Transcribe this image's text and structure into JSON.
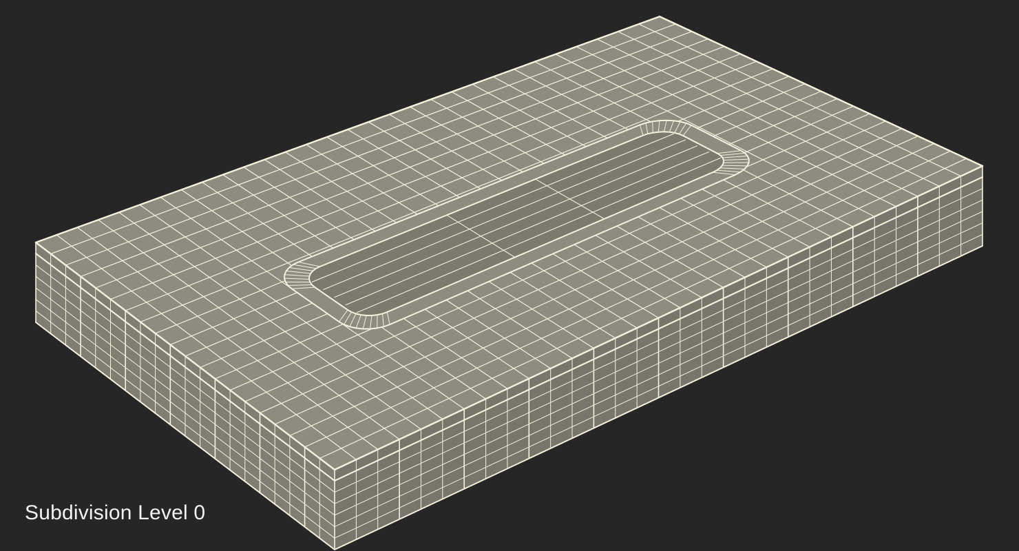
{
  "caption": "Subdivision Level 0",
  "colors": {
    "background": "#262626",
    "top_face": "#8d8c80",
    "left_face": "#7f7e73",
    "front_face": "#77766c",
    "basin": "#7a7a6f",
    "wire": "#f4f1dc"
  }
}
